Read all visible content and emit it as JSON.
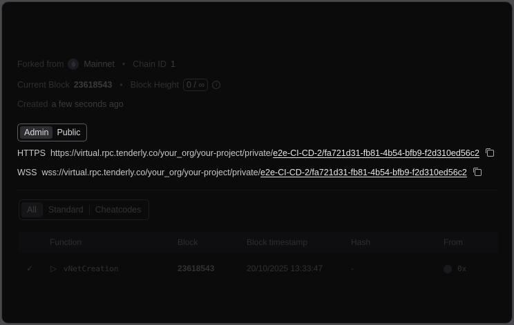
{
  "meta": {
    "forked_from_label": "Forked from",
    "network": "Mainnet",
    "chain_id_label": "Chain ID",
    "chain_id": "1",
    "current_block_label": "Current Block",
    "current_block": "23618543",
    "block_height_label": "Block Height",
    "block_height": "0 / ∞",
    "created_label": "Created",
    "created_value": "a few seconds ago"
  },
  "access_tabs": [
    "Admin",
    "Public"
  ],
  "rpc": {
    "https_label": "HTTPS",
    "https_prefix": "https://virtual.rpc.tenderly.co/your_org/your-project/private/",
    "https_tail": "e2e-CI-CD-2/fa721d31-fb81-4b54-bfb9-f2d310ed56c2",
    "wss_label": "WSS",
    "wss_prefix": "wss://virtual.rpc.tenderly.co/your_org/your-project/private/",
    "wss_tail": "e2e-CI-CD-2/fa721d31-fb81-4b54-bfb9-f2d310ed56c2"
  },
  "tx_filters": [
    "All",
    "Standard",
    "Cheatcodes"
  ],
  "table": {
    "columns": [
      "Function",
      "Block",
      "Block timestamp",
      "Hash",
      "From"
    ],
    "rows": [
      {
        "status": "✓",
        "function": "vNetCreation",
        "block": "23618543",
        "timestamp": "20/10/2025 13:33:47",
        "hash": "-",
        "from": "0x"
      }
    ]
  },
  "icons": [
    "ethereum-icon",
    "info-icon",
    "copy-icon",
    "check-icon",
    "play-icon"
  ]
}
